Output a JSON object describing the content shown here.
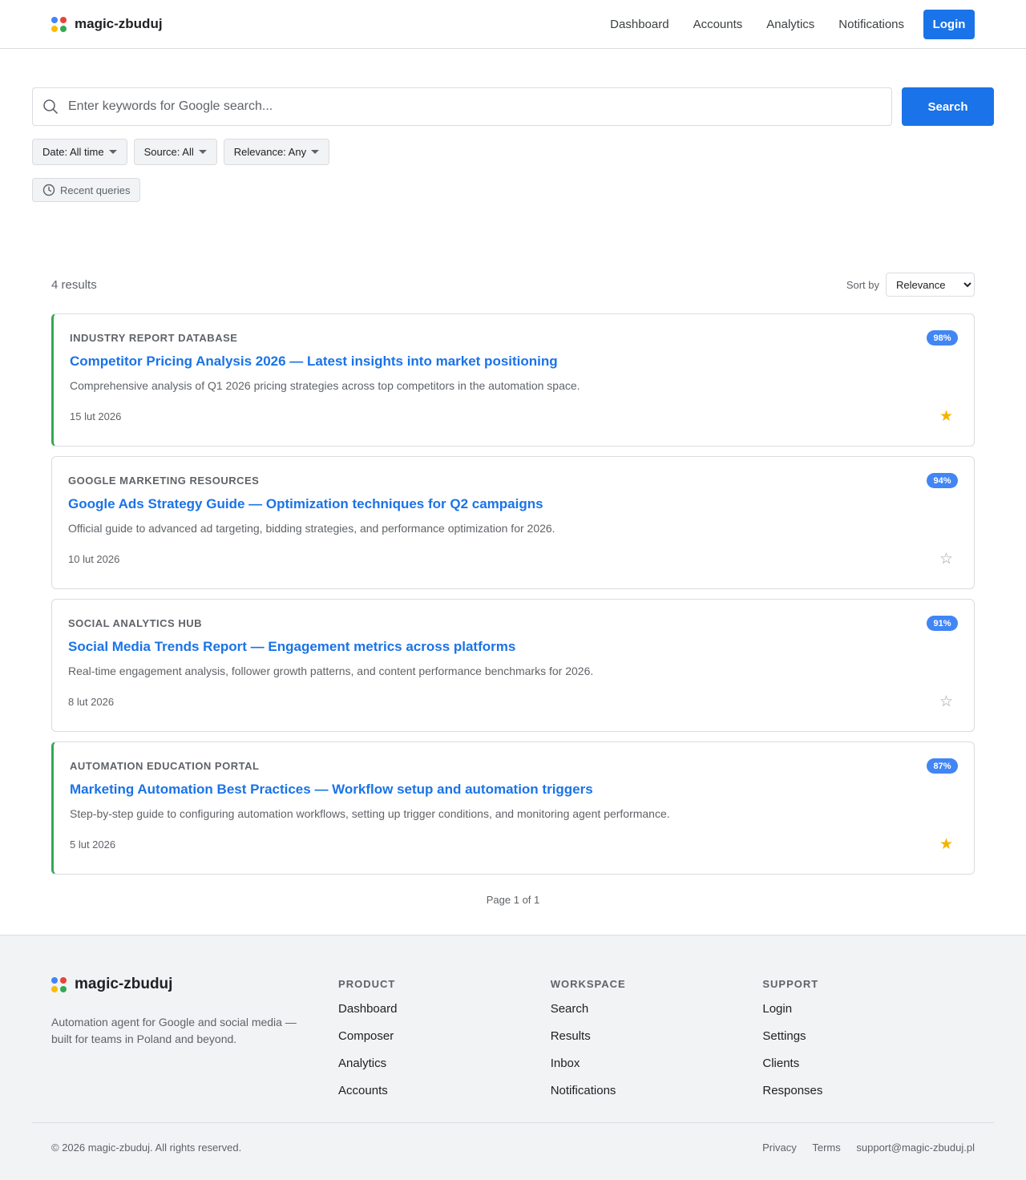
{
  "brand": {
    "name": "magic-zbuduj",
    "colors": [
      "#4285f4",
      "#ea4335",
      "#fbbc05",
      "#34a853"
    ]
  },
  "nav": {
    "items": [
      "Dashboard",
      "Accounts",
      "Analytics",
      "Notifications"
    ],
    "login_label": "Login"
  },
  "search": {
    "placeholder": "Enter keywords for Google search...",
    "value": "",
    "button_label": "Search",
    "filters": [
      "Date: All time",
      "Source: All",
      "Relevance: Any"
    ],
    "recent_label": "Recent queries"
  },
  "results": {
    "count_label": "4 results",
    "sort_label": "Sort by",
    "sort_value": "Relevance",
    "items": [
      {
        "source": "Industry Report Database",
        "title": "Competitor Pricing Analysis 2026 — Latest insights into market positioning",
        "desc": "Comprehensive analysis of Q1 2026 pricing strategies across top competitors in the automation space.",
        "date": "15 lut 2026",
        "score": "98%",
        "starred": true
      },
      {
        "source": "Google Marketing Resources",
        "title": "Google Ads Strategy Guide — Optimization techniques for Q2 campaigns",
        "desc": "Official guide to advanced ad targeting, bidding strategies, and performance optimization for 2026.",
        "date": "10 lut 2026",
        "score": "94%",
        "starred": false
      },
      {
        "source": "Social Analytics Hub",
        "title": "Social Media Trends Report — Engagement metrics across platforms",
        "desc": "Real-time engagement analysis, follower growth patterns, and content performance benchmarks for 2026.",
        "date": "8 lut 2026",
        "score": "91%",
        "starred": false
      },
      {
        "source": "Automation Education Portal",
        "title": "Marketing Automation Best Practices — Workflow setup and automation triggers",
        "desc": "Step-by-step guide to configuring automation workflows, setting up trigger conditions, and monitoring agent performance.",
        "date": "5 lut 2026",
        "score": "87%",
        "starred": true
      }
    ],
    "pager": "Page 1 of 1"
  },
  "footer": {
    "tagline": "Automation agent for Google and social media — built for teams in Poland and beyond.",
    "columns": [
      {
        "title": "PRODUCT",
        "links": [
          "Dashboard",
          "Composer",
          "Analytics",
          "Accounts"
        ]
      },
      {
        "title": "WORKSPACE",
        "links": [
          "Search",
          "Results",
          "Inbox",
          "Notifications"
        ]
      },
      {
        "title": "SUPPORT",
        "links": [
          "Login",
          "Settings",
          "Clients",
          "Responses"
        ]
      }
    ],
    "copyright": "© 2026 magic-zbuduj. All rights reserved.",
    "bottom_links": [
      "Privacy",
      "Terms",
      "support@magic-zbuduj.pl"
    ]
  }
}
